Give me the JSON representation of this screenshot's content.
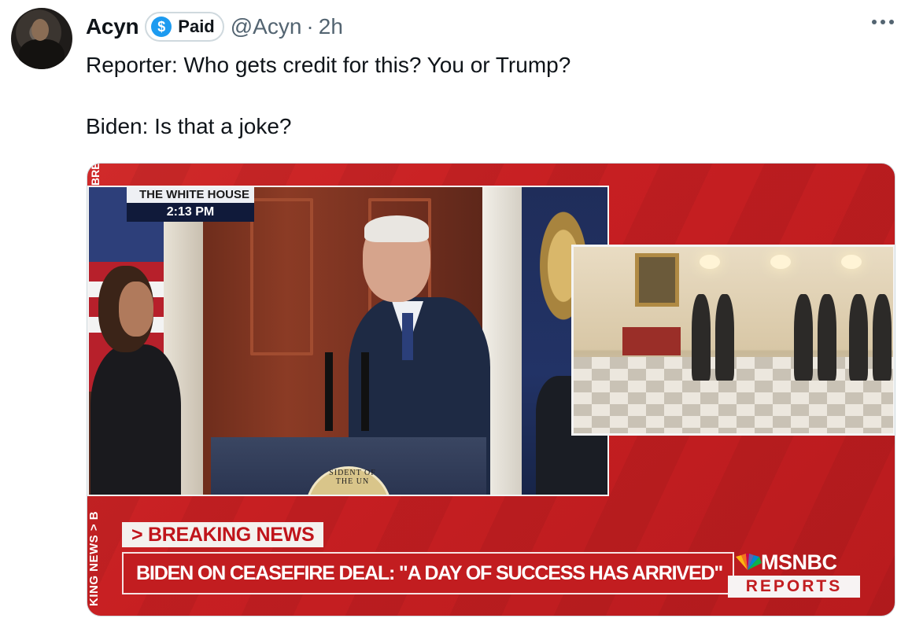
{
  "tweet": {
    "display_name": "Acyn",
    "badge_label": "Paid",
    "badge_icon": "dollar-icon",
    "badge_symbol": "$",
    "handle": "@Acyn",
    "separator": "·",
    "timestamp": "2h",
    "text_lines": [
      "Reporter: Who gets credit for this? You or Trump?",
      "Biden: Is that a joke?"
    ],
    "more_icon": "more-horizontal-icon"
  },
  "media": {
    "location_top": "THE WHITE HOUSE",
    "location_time": "2:13 PM",
    "side_top_text": "BRE",
    "side_bottom_text": "KING NEWS > B",
    "podium_seal_text": "SIDENT OF THE UN",
    "breaking_label": "> BREAKING NEWS",
    "headline": "BIDEN ON CEASEFIRE DEAL: \"A DAY OF SUCCESS HAS ARRIVED\"",
    "network": "MSNBC",
    "network_sub": "REPORTS",
    "colors": {
      "background_red": "#c71f22",
      "navy": "#101a3a",
      "link_blue": "#1d9bf0",
      "muted": "#536471"
    }
  }
}
